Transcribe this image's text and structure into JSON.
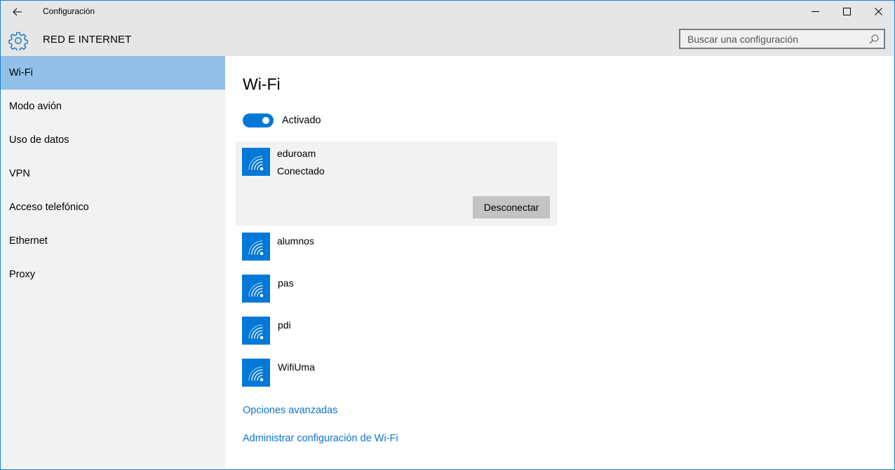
{
  "window": {
    "app_title": "Configuración",
    "controls": {
      "minimize": "minimize-icon",
      "maximize": "maximize-icon",
      "close": "close-icon"
    }
  },
  "header": {
    "section_icon": "gear-icon",
    "section_title": "RED E INTERNET",
    "search": {
      "placeholder": "Buscar una configuración",
      "value": "",
      "icon": "search-icon"
    }
  },
  "sidebar": {
    "items": [
      {
        "label": "Wi-Fi",
        "selected": true
      },
      {
        "label": "Modo avión",
        "selected": false
      },
      {
        "label": "Uso de datos",
        "selected": false
      },
      {
        "label": "VPN",
        "selected": false
      },
      {
        "label": "Acceso telefónico",
        "selected": false
      },
      {
        "label": "Ethernet",
        "selected": false
      },
      {
        "label": "Proxy",
        "selected": false
      }
    ]
  },
  "main": {
    "title": "Wi-Fi",
    "toggle": {
      "state": "on",
      "label": "Activado"
    },
    "connected_network": {
      "name": "eduroam",
      "status": "Conectado",
      "action_label": "Desconectar",
      "icon": "wifi-icon"
    },
    "networks": [
      {
        "name": "alumnos",
        "icon": "wifi-icon"
      },
      {
        "name": "pas",
        "icon": "wifi-icon"
      },
      {
        "name": "pdi",
        "icon": "wifi-icon"
      },
      {
        "name": "WifiUma",
        "icon": "wifi-icon"
      }
    ],
    "links": {
      "advanced": "Opciones avanzadas",
      "manage": "Administrar configuración de Wi-Fi"
    }
  },
  "colors": {
    "accent": "#0078d7",
    "selected_nav": "#92c0e8",
    "link": "#0a75cf",
    "window_border": "#1883d7"
  }
}
